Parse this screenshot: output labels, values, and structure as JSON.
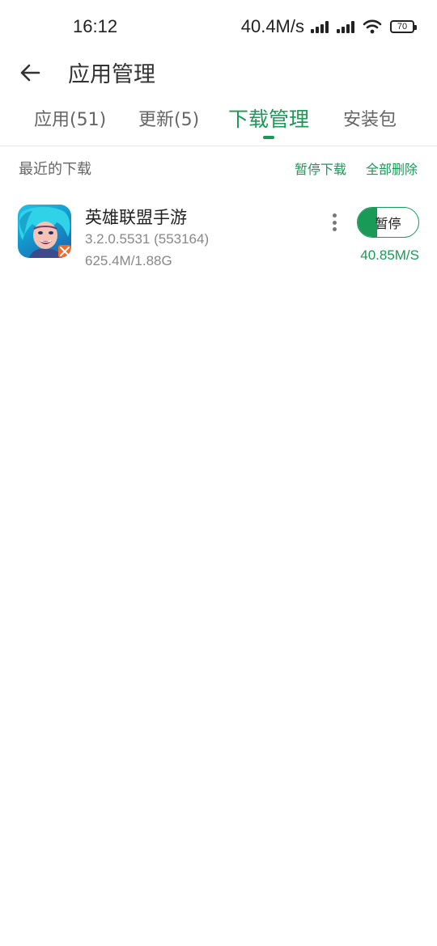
{
  "status_bar": {
    "time": "16:12",
    "net_speed": "40.4M/s",
    "battery": "70"
  },
  "header": {
    "title": "应用管理"
  },
  "tabs": [
    {
      "label": "应用(51)",
      "active": false
    },
    {
      "label": "更新(5)",
      "active": false
    },
    {
      "label": "下载管理",
      "active": true
    },
    {
      "label": "安装包",
      "active": false
    }
  ],
  "section": {
    "title": "最近的下载",
    "pause_all_label": "暂停下载",
    "delete_all_label": "全部删除"
  },
  "downloads": [
    {
      "name": "英雄联盟手游",
      "version": "3.2.0.5531 (553164)",
      "progress_text": "625.4M/1.88G",
      "progress_fraction": 0.32,
      "button_label": "暂停",
      "speed": "40.85M/S",
      "icon": "league-of-legends-wild-rift-app-icon"
    }
  ],
  "colors": {
    "accent": "#1a9a57",
    "text_primary": "#222222",
    "text_secondary": "#888888",
    "background": "#ffffff"
  }
}
